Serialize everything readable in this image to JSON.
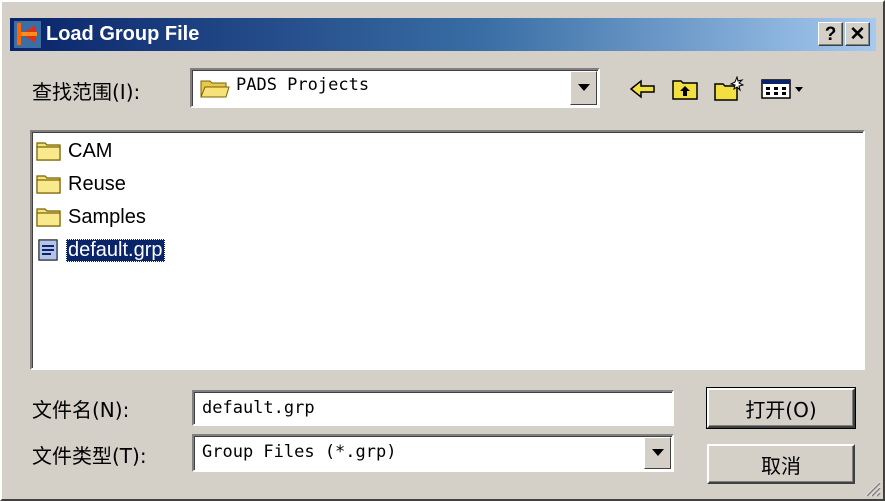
{
  "dialog": {
    "title": "Load Group File",
    "help_label": "?",
    "close_label": "✕"
  },
  "lookin": {
    "label": "查找范围(I):",
    "value": "PADS Projects"
  },
  "files": [
    {
      "name": "CAM",
      "type": "folder"
    },
    {
      "name": "Reuse",
      "type": "folder"
    },
    {
      "name": "Samples",
      "type": "folder"
    },
    {
      "name": "default.grp",
      "type": "file",
      "selected": true
    }
  ],
  "filename": {
    "label": "文件名(N):",
    "value": "default.grp"
  },
  "filetype": {
    "label": "文件类型(T):",
    "value": "Group Files (*.grp)"
  },
  "buttons": {
    "open": "打开(O)",
    "cancel": "取消"
  },
  "colors": {
    "title_start": "#0a246a",
    "title_end": "#a6caf0",
    "selection": "#0a246a",
    "face": "#d4d0c8"
  }
}
